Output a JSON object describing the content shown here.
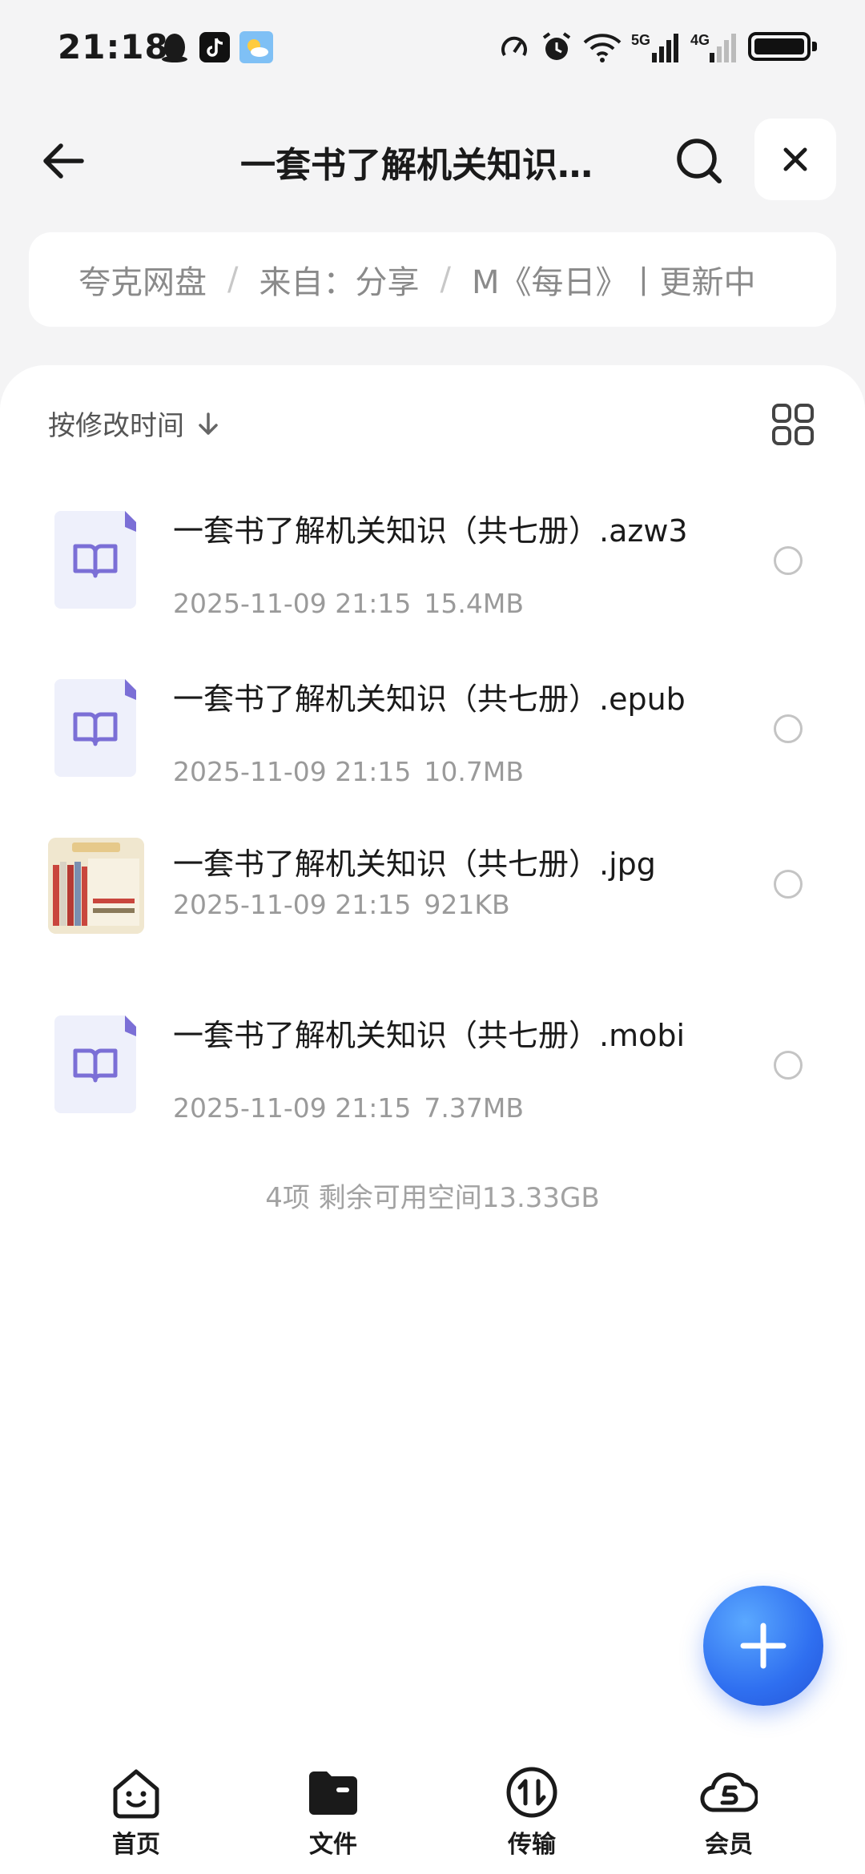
{
  "status_bar": {
    "time": "21:18",
    "app_icons": [
      "qq-penguin-icon",
      "tiktok-icon",
      "weather-icon"
    ],
    "right_icons": [
      "data-speed-icon",
      "alarm-icon",
      "wifi-icon",
      "5g-signal-icon",
      "4g-signal-icon",
      "battery-icon"
    ],
    "sig_5g": "5G",
    "sig_4g": "4G"
  },
  "header": {
    "title": "一套书了解机关知识（共七册）",
    "back_icon": "back-arrow-icon",
    "search_icon": "search-icon",
    "close_icon": "close-icon"
  },
  "breadcrumb": {
    "items": [
      "夸克网盘",
      "来自：分享",
      "M《每日》丨更新中"
    ],
    "separator": "/"
  },
  "sort": {
    "label": "按修改时间",
    "icon": "arrow-down-icon",
    "view_toggle_icon": "grid-view-icon"
  },
  "files": [
    {
      "name": "一套书了解机关知识（共七册）.azw3",
      "date": "2025-11-09 21:15",
      "size": "15.4MB",
      "icon": "book-file-icon"
    },
    {
      "name": "一套书了解机关知识（共七册）.epub",
      "date": "2025-11-09 21:15",
      "size": "10.7MB",
      "icon": "book-file-icon"
    },
    {
      "name": "一套书了解机关知识（共七册）.jpg",
      "date": "2025-11-09 21:15",
      "size": "921KB",
      "icon": "image-thumbnail"
    },
    {
      "name": "一套书了解机关知识（共七册）.mobi",
      "date": "2025-11-09 21:15",
      "size": "7.37MB",
      "icon": "book-file-icon"
    }
  ],
  "summary": "4项 剩余可用空间13.33GB",
  "fab_icon": "plus-icon",
  "nav": [
    {
      "label": "首页",
      "icon": "home-face-icon"
    },
    {
      "label": "文件",
      "icon": "folder-icon"
    },
    {
      "label": "传输",
      "icon": "transfer-icon"
    },
    {
      "label": "会员",
      "icon": "vip-cloud-icon"
    }
  ],
  "colors": {
    "accent": "#2f6ff0",
    "book_icon": "#7b6fd6",
    "book_bg": "#eef0fb"
  }
}
